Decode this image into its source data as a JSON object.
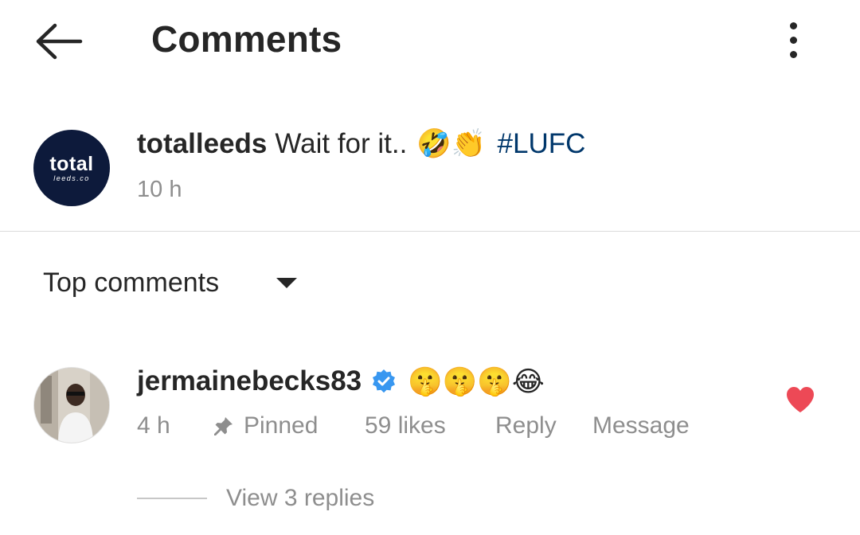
{
  "header": {
    "title": "Comments",
    "back_icon": "arrow-left-icon",
    "more_icon": "more-vertical-icon"
  },
  "post": {
    "avatar_logo": "total",
    "avatar_logo_sub": "leeds.co",
    "username": "totalleeds",
    "caption": "Wait for it..",
    "emojis": "🤣👏",
    "hashtag": "#LUFC",
    "time": "10 h"
  },
  "sort": {
    "label": "Top comments"
  },
  "comment": {
    "username": "jermainebecks83",
    "verified": true,
    "text": "🤫🤫🤫😂",
    "time": "4 h",
    "pinned_label": "Pinned",
    "likes": "59 likes",
    "reply_label": "Reply",
    "message_label": "Message",
    "liked": true,
    "view_replies": "View 3 replies"
  },
  "colors": {
    "text": "#262626",
    "secondary": "#8e8e8e",
    "link": "#00376b",
    "like": "#ed4956",
    "verified": "#3897f0",
    "avatar_bg": "#0d1a3b"
  }
}
